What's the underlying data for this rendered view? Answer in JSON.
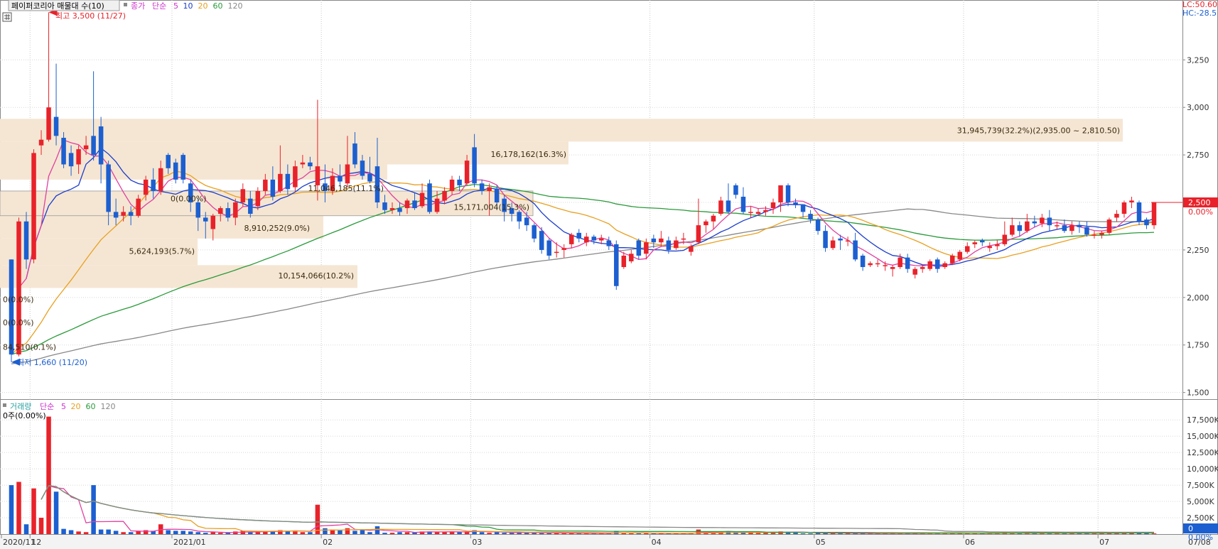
{
  "legend_top": {
    "title": "페이퍼코리아 매물대 수(10)",
    "items": [
      {
        "label": "종가",
        "color": "#cc33cc"
      },
      {
        "label": "단순",
        "color": "#cc33cc"
      },
      {
        "label": "5",
        "color": "#cc33cc"
      },
      {
        "label": "10",
        "color": "#1a3ccc"
      },
      {
        "label": "20",
        "color": "#e8a020"
      },
      {
        "label": "60",
        "color": "#2a9a3a"
      },
      {
        "label": "120",
        "color": "#888888"
      }
    ]
  },
  "legend_bottom": {
    "items": [
      {
        "label": "거래량",
        "color": "#2aa0a0"
      },
      {
        "label": "단순",
        "color": "#cc33cc"
      },
      {
        "label": "5",
        "color": "#cc33cc"
      },
      {
        "label": "20",
        "color": "#e8a020"
      },
      {
        "label": "60",
        "color": "#2a9a3a"
      },
      {
        "label": "120",
        "color": "#888888"
      }
    ],
    "zero_label": "0주(0.00%)"
  },
  "corner": {
    "lc": "LC:50.60",
    "hc": "HC:-28.5"
  },
  "colors": {
    "up": "#e8222a",
    "down": "#1c5fd0",
    "zone": "#f5e6d3",
    "ma5": "#e040a0",
    "ma10": "#1a3ccc",
    "ma20": "#e8a020",
    "ma60": "#2a9a3a",
    "ma120": "#888888"
  },
  "chart_data": {
    "type": "candlestick",
    "x_labels": [
      "2020/11",
      "12",
      "2021/01",
      "02",
      "03",
      "04",
      "05",
      "06",
      "07",
      "07/08"
    ],
    "price_axis": {
      "ticks": [
        "3,250",
        "3,000",
        "2,750",
        "2,500",
        "2,250",
        "2,000",
        "1,750",
        "1,500"
      ],
      "range": [
        1480,
        3550
      ]
    },
    "volume_axis": {
      "ticks": [
        "17,500K",
        "15,000K",
        "12,500K",
        "10,000K",
        "7,500K",
        "5,000K",
        "2,500K"
      ],
      "range": [
        0,
        18500
      ]
    },
    "current_price": {
      "label": "2,500",
      "pct": "0.00%"
    },
    "current_volume": {
      "label": "0",
      "pct": "0.00%"
    },
    "annotations": {
      "high": "최고 3,500 (11/27)",
      "low": "최저 1,660 (11/20)"
    },
    "volume_profile": [
      {
        "label": "31,945,739(32.2%)(2,935.00 ~ 2,810.50)",
        "value": 31945739,
        "pct": 32.2
      },
      {
        "label": "16,178,162(16.3%)",
        "value": 16178162,
        "pct": 16.3
      },
      {
        "label": "11,046,185(11.1%)",
        "value": 11046185,
        "pct": 11.1
      },
      {
        "label": "15,171,004(15.3%)",
        "value": 15171004,
        "pct": 15.3
      },
      {
        "label": "0(0.00%)",
        "value": 0,
        "pct": 0
      },
      {
        "label": "8,910,252(9.0%)",
        "value": 8910252,
        "pct": 9.0
      },
      {
        "label": "5,624,193(5.7%)",
        "value": 5624193,
        "pct": 5.7
      },
      {
        "label": "10,154,066(10.2%)",
        "value": 10154066,
        "pct": 10.2
      },
      {
        "label": "0(0.0%)",
        "value": 0,
        "pct": 0
      },
      {
        "label": "0(0.0%)",
        "value": 0,
        "pct": 0
      },
      {
        "label": "84,510(0.1%)",
        "value": 84510,
        "pct": 0.1
      }
    ],
    "price_zones": [
      [
        2940,
        2820
      ],
      [
        2820,
        2700
      ],
      [
        2700,
        2620
      ],
      [
        2560,
        2430
      ],
      [
        2520,
        2430
      ],
      [
        2430,
        2310
      ],
      [
        2310,
        2170
      ],
      [
        2170,
        2050
      ]
    ],
    "candles": [
      [
        2200,
        1700,
        2200,
        1660,
        7500
      ],
      [
        1700,
        2400,
        2420,
        1690,
        8000
      ],
      [
        2400,
        2200,
        2450,
        2150,
        1500
      ],
      [
        2200,
        2760,
        2780,
        2180,
        7000
      ],
      [
        2800,
        2830,
        2880,
        2750,
        2500
      ],
      [
        2830,
        3000,
        3500,
        2820,
        18000
      ],
      [
        2950,
        2850,
        3230,
        2800,
        6500
      ],
      [
        2840,
        2700,
        2870,
        2680,
        800
      ],
      [
        2760,
        2690,
        2800,
        2640,
        600
      ],
      [
        2700,
        2780,
        2800,
        2650,
        400
      ],
      [
        2780,
        2800,
        2850,
        2750,
        300
      ],
      [
        2850,
        2750,
        3190,
        2720,
        7500
      ],
      [
        2900,
        2700,
        2950,
        2600,
        700
      ],
      [
        2700,
        2450,
        2720,
        2380,
        700
      ],
      [
        2450,
        2420,
        2520,
        2380,
        500
      ],
      [
        2430,
        2450,
        2480,
        2400,
        300
      ],
      [
        2450,
        2430,
        2480,
        2380,
        300
      ],
      [
        2430,
        2520,
        2540,
        2420,
        500
      ],
      [
        2540,
        2620,
        2640,
        2510,
        600
      ],
      [
        2620,
        2560,
        2680,
        2520,
        500
      ],
      [
        2560,
        2680,
        2720,
        2540,
        1500
      ],
      [
        2750,
        2680,
        2760,
        2650,
        600
      ],
      [
        2710,
        2620,
        2730,
        2600,
        500
      ],
      [
        2750,
        2620,
        2760,
        2600,
        500
      ],
      [
        2600,
        2500,
        2620,
        2450,
        400
      ],
      [
        2500,
        2420,
        2520,
        2350,
        300
      ],
      [
        2420,
        2400,
        2450,
        2310,
        200
      ],
      [
        2360,
        2430,
        2440,
        2300,
        300
      ],
      [
        2440,
        2470,
        2480,
        2400,
        200
      ],
      [
        2470,
        2420,
        2500,
        2400,
        200
      ],
      [
        2420,
        2500,
        2520,
        2380,
        400
      ],
      [
        2500,
        2570,
        2600,
        2480,
        500
      ],
      [
        2520,
        2440,
        2560,
        2420,
        300
      ],
      [
        2480,
        2560,
        2580,
        2460,
        300
      ],
      [
        2560,
        2620,
        2650,
        2540,
        400
      ],
      [
        2620,
        2530,
        2690,
        2510,
        500
      ],
      [
        2560,
        2650,
        2800,
        2550,
        600
      ],
      [
        2650,
        2570,
        2700,
        2540,
        500
      ],
      [
        2580,
        2690,
        2720,
        2560,
        500
      ],
      [
        2700,
        2710,
        2750,
        2680,
        300
      ],
      [
        2710,
        2690,
        2740,
        2670,
        300
      ],
      [
        2590,
        2690,
        3040,
        2510,
        4500
      ],
      [
        2600,
        2560,
        2700,
        2500,
        900
      ],
      [
        2560,
        2640,
        2680,
        2540,
        700
      ],
      [
        2640,
        2610,
        2700,
        2590,
        600
      ],
      [
        2600,
        2700,
        2850,
        2580,
        900
      ],
      [
        2810,
        2700,
        2870,
        2680,
        500
      ],
      [
        2720,
        2640,
        2750,
        2620,
        600
      ],
      [
        2650,
        2610,
        2740,
        2600,
        300
      ],
      [
        2690,
        2500,
        2840,
        2470,
        1200
      ],
      [
        2500,
        2460,
        2540,
        2440,
        200
      ],
      [
        2460,
        2470,
        2500,
        2440,
        200
      ],
      [
        2470,
        2450,
        2500,
        2430,
        300
      ],
      [
        2470,
        2510,
        2520,
        2440,
        300
      ],
      [
        2510,
        2470,
        2550,
        2460,
        300
      ],
      [
        2480,
        2550,
        2600,
        2470,
        400
      ],
      [
        2600,
        2450,
        2620,
        2440,
        400
      ],
      [
        2450,
        2520,
        2560,
        2440,
        300
      ],
      [
        2510,
        2560,
        2580,
        2490,
        300
      ],
      [
        2560,
        2620,
        2640,
        2540,
        400
      ],
      [
        2620,
        2590,
        2640,
        2560,
        300
      ],
      [
        2600,
        2720,
        2750,
        2590,
        400
      ],
      [
        2790,
        2600,
        2860,
        2580,
        600
      ],
      [
        2600,
        2560,
        2620,
        2540,
        300
      ],
      [
        2560,
        2580,
        2600,
        2430,
        200
      ],
      [
        2570,
        2500,
        2590,
        2460,
        300
      ],
      [
        2520,
        2450,
        2540,
        2400,
        200
      ],
      [
        2470,
        2440,
        2500,
        2400,
        200
      ],
      [
        2450,
        2400,
        2460,
        2360,
        300
      ],
      [
        2420,
        2380,
        2450,
        2350,
        200
      ],
      [
        2380,
        2310,
        2390,
        2290,
        200
      ],
      [
        2350,
        2250,
        2370,
        2230,
        150
      ],
      [
        2300,
        2220,
        2310,
        2200,
        150
      ],
      [
        2240,
        2240,
        2290,
        2210,
        200
      ],
      [
        2250,
        2260,
        2280,
        2210,
        100
      ],
      [
        2280,
        2330,
        2340,
        2260,
        150
      ],
      [
        2340,
        2310,
        2360,
        2290,
        100
      ],
      [
        2290,
        2320,
        2340,
        2270,
        100
      ],
      [
        2320,
        2300,
        2330,
        2280,
        100
      ],
      [
        2300,
        2310,
        2330,
        2280,
        100
      ],
      [
        2300,
        2270,
        2320,
        2250,
        100
      ],
      [
        2280,
        2060,
        2300,
        2040,
        500
      ],
      [
        2160,
        2220,
        2240,
        2150,
        200
      ],
      [
        2190,
        2230,
        2250,
        2180,
        100
      ],
      [
        2300,
        2220,
        2310,
        2200,
        100
      ],
      [
        2230,
        2290,
        2310,
        2200,
        150
      ],
      [
        2310,
        2290,
        2330,
        2260,
        100
      ],
      [
        2290,
        2310,
        2350,
        2270,
        100
      ],
      [
        2300,
        2250,
        2320,
        2230,
        100
      ],
      [
        2260,
        2300,
        2320,
        2250,
        100
      ],
      [
        2310,
        2310,
        2340,
        2280,
        100
      ],
      [
        2240,
        2270,
        2280,
        2220,
        100
      ],
      [
        2290,
        2380,
        2520,
        2280,
        700
      ],
      [
        2380,
        2400,
        2410,
        2340,
        300
      ],
      [
        2400,
        2430,
        2440,
        2360,
        300
      ],
      [
        2440,
        2510,
        2530,
        2430,
        400
      ],
      [
        2510,
        2450,
        2600,
        2440,
        400
      ],
      [
        2590,
        2540,
        2600,
        2520,
        400
      ],
      [
        2530,
        2450,
        2580,
        2440,
        300
      ],
      [
        2450,
        2450,
        2480,
        2420,
        200
      ],
      [
        2440,
        2450,
        2470,
        2430,
        150
      ],
      [
        2450,
        2460,
        2480,
        2430,
        200
      ],
      [
        2470,
        2500,
        2520,
        2440,
        300
      ],
      [
        2500,
        2590,
        2590,
        2450,
        400
      ],
      [
        2590,
        2500,
        2600,
        2480,
        350
      ],
      [
        2500,
        2490,
        2520,
        2470,
        300
      ],
      [
        2490,
        2450,
        2490,
        2420,
        100
      ],
      [
        2440,
        2410,
        2460,
        2390,
        100
      ],
      [
        2410,
        2350,
        2420,
        2330,
        200
      ],
      [
        2350,
        2260,
        2380,
        2240,
        150
      ],
      [
        2260,
        2300,
        2320,
        2250,
        200
      ],
      [
        2310,
        2300,
        2330,
        2250,
        100
      ],
      [
        2300,
        2300,
        2320,
        2270,
        100
      ],
      [
        2300,
        2200,
        2340,
        2190,
        100
      ],
      [
        2220,
        2160,
        2230,
        2140,
        100
      ],
      [
        2170,
        2180,
        2190,
        2160,
        100
      ],
      [
        2180,
        2180,
        2200,
        2160,
        100
      ],
      [
        2170,
        2170,
        2190,
        2140,
        100
      ],
      [
        2150,
        2160,
        2170,
        2110,
        100
      ],
      [
        2160,
        2210,
        2230,
        2150,
        100
      ],
      [
        2210,
        2150,
        2230,
        2130,
        100
      ],
      [
        2120,
        2150,
        2160,
        2100,
        100
      ],
      [
        2150,
        2160,
        2170,
        2130,
        100
      ],
      [
        2150,
        2190,
        2200,
        2140,
        100
      ],
      [
        2200,
        2150,
        2210,
        2130,
        100
      ],
      [
        2160,
        2180,
        2190,
        2150,
        150
      ],
      [
        2180,
        2220,
        2230,
        2170,
        100
      ],
      [
        2200,
        2240,
        2250,
        2190,
        100
      ],
      [
        2240,
        2270,
        2290,
        2230,
        150
      ],
      [
        2280,
        2290,
        2300,
        2260,
        100
      ],
      [
        2300,
        2290,
        2310,
        2270,
        100
      ],
      [
        2260,
        2270,
        2290,
        2240,
        100
      ],
      [
        2270,
        2280,
        2300,
        2250,
        150
      ],
      [
        2280,
        2330,
        2400,
        2270,
        250
      ],
      [
        2330,
        2380,
        2420,
        2320,
        150
      ],
      [
        2380,
        2350,
        2400,
        2320,
        100
      ],
      [
        2350,
        2400,
        2440,
        2340,
        250
      ],
      [
        2400,
        2390,
        2430,
        2370,
        200
      ],
      [
        2390,
        2420,
        2440,
        2370,
        200
      ],
      [
        2420,
        2380,
        2460,
        2350,
        100
      ],
      [
        2380,
        2380,
        2400,
        2360,
        100
      ],
      [
        2380,
        2350,
        2410,
        2340,
        100
      ],
      [
        2350,
        2380,
        2400,
        2330,
        200
      ],
      [
        2380,
        2370,
        2400,
        2340,
        150
      ],
      [
        2370,
        2330,
        2400,
        2320,
        150
      ],
      [
        2330,
        2330,
        2350,
        2310,
        100
      ],
      [
        2330,
        2340,
        2350,
        2310,
        100
      ],
      [
        2340,
        2410,
        2420,
        2330,
        200
      ],
      [
        2420,
        2440,
        2460,
        2400,
        200
      ],
      [
        2440,
        2500,
        2510,
        2420,
        200
      ],
      [
        2500,
        2510,
        2530,
        2470,
        200
      ],
      [
        2500,
        2400,
        2510,
        2380,
        200
      ],
      [
        2410,
        2380,
        2420,
        2360,
        150
      ],
      [
        2380,
        2500,
        2500,
        2360,
        100
      ]
    ]
  }
}
